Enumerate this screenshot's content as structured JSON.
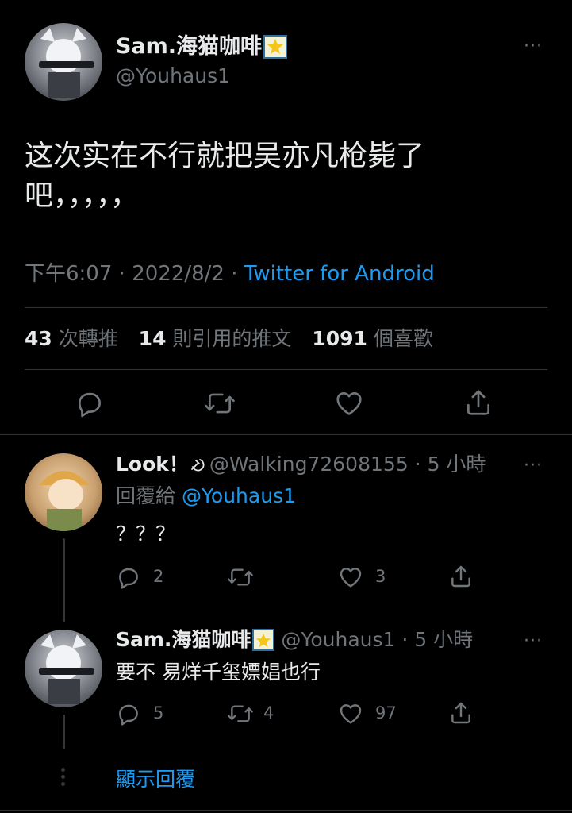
{
  "main_tweet": {
    "display_name": "Sam.海猫咖啡",
    "handle": "@Youhaus1",
    "more": "···",
    "text_line1": "这次实在不行就把吴亦凡枪毙了",
    "text_line2": "吧，，，，，",
    "time": "下午6:07",
    "sep1": "·",
    "date": "2022/8/2",
    "sep2": "·",
    "source": "Twitter for Android",
    "stats": {
      "retweets": "43",
      "retweets_label": "次轉推",
      "quotes": "14",
      "quotes_label": "則引用的推文",
      "likes": "1091",
      "likes_label": "個喜歡"
    }
  },
  "replies": [
    {
      "display_name": "Look！",
      "handle": "@Walking72608155",
      "sep": "·",
      "time": "5 小時",
      "more": "···",
      "replying_to_label": "回覆給",
      "replying_to_handle": "@Youhaus1",
      "text": "？？？",
      "reply_count": "2",
      "retweet_count": "",
      "like_count": "3"
    },
    {
      "display_name": "Sam.海猫咖啡",
      "handle": "@Youhaus1",
      "sep": "·",
      "time": "5 小時",
      "more": "···",
      "text": "要不 易烊千玺嫖娼也行",
      "reply_count": "5",
      "retweet_count": "4",
      "like_count": "97"
    }
  ],
  "show_replies": "顯示回覆",
  "colors": {
    "background": "#000000",
    "text": "#e7e9ea",
    "muted": "#71767b",
    "accent": "#1d9bf0",
    "divider": "#2f3336"
  },
  "icons": [
    "reply-icon",
    "retweet-icon",
    "like-icon",
    "share-icon",
    "more-icon",
    "emoji-badge-icon",
    "hammer-sickle-icon"
  ]
}
